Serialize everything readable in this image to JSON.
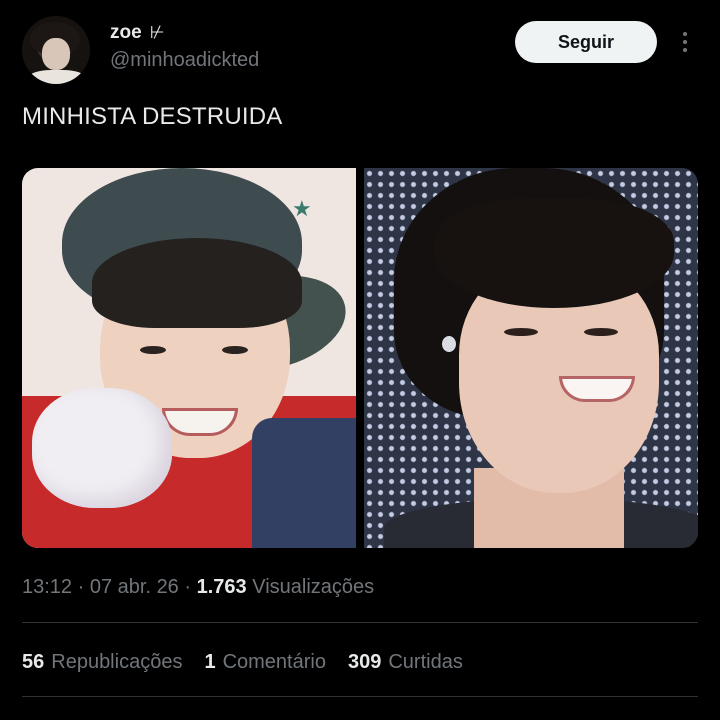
{
  "author": {
    "display_name": "zoe",
    "name_glyph": "⊬",
    "handle": "@minhoadickted"
  },
  "actions": {
    "follow_label": "Seguir",
    "more_icon": "more-vertical-icon"
  },
  "tweet": {
    "text": "MINHISTA DESTRUIDA",
    "media_count": 2
  },
  "meta": {
    "time": "13:12",
    "separator1": " · ",
    "date": "07 abr. 26",
    "separator2": " · ",
    "views_count": "1.763",
    "views_label": " Visualizações"
  },
  "stats": {
    "reposts_count": "56",
    "reposts_label": "Republicações",
    "comments_count": "1",
    "comments_label": "Comentário",
    "likes_count": "309",
    "likes_label": "Curtidas"
  },
  "colors": {
    "background": "#000000",
    "text_primary": "#e7e9ea",
    "text_secondary": "#71767b",
    "button_bg": "#eff3f4",
    "divider": "#2f3336"
  }
}
